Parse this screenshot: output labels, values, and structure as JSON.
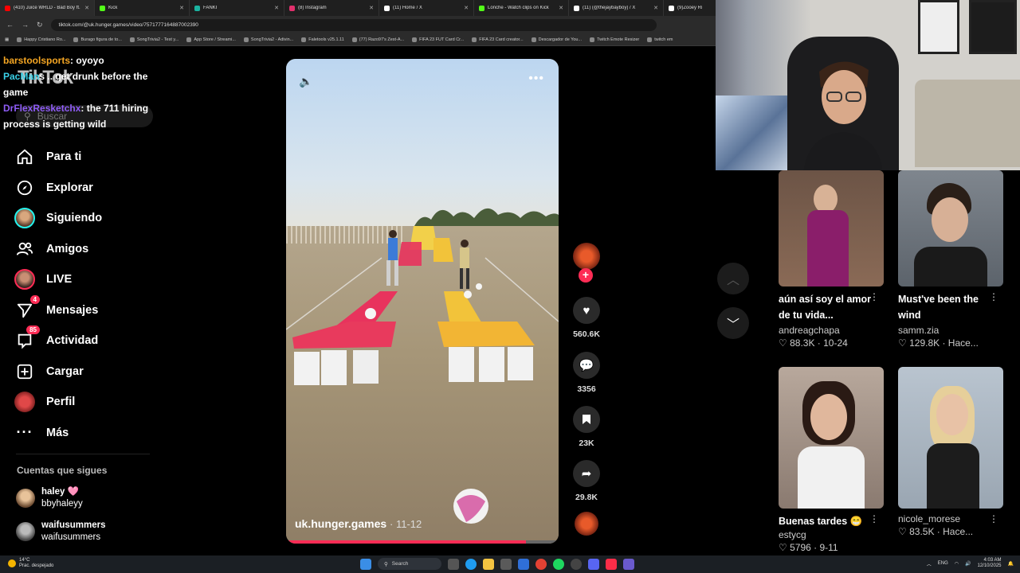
{
  "browser": {
    "tabs": [
      {
        "title": "(410) Juice WRLD - Bad Boy ft.",
        "color": "#ff0000"
      },
      {
        "title": "Kick",
        "color": "#53fc18"
      },
      {
        "title": "FANKI",
        "color": "#1bb3a0"
      },
      {
        "title": "(8) Instagram",
        "color": "#e1306c"
      },
      {
        "title": "(11) Home / X",
        "color": "#ffffff"
      },
      {
        "title": "Lonche - Watch clips on Kick",
        "color": "#53fc18"
      },
      {
        "title": "(11) (@thejaybayboy) / X",
        "color": "#ffffff"
      },
      {
        "title": "(9)Zooey Ri",
        "color": "#ffffff"
      }
    ],
    "url": "tiktok.com/@uk.hunger.games/video/7571777164887002390",
    "bookmarks": [
      "Happy Cristiano Ro...",
      "Burago figura de to...",
      "SongTrivia2 - Test y...",
      "App Store / Streami...",
      "SongTrivia2 - Adivin...",
      "Faletools v25.1.11",
      "(77) Razo97's Zest-A...",
      "FIFA 23 FUT Card Cr...",
      "FIFA 23 Card creator...",
      "Descargador de You...",
      "Twitch Emote Resizer",
      "twitch em"
    ]
  },
  "sidebar": {
    "logo": "TikTok",
    "search_placeholder": "Buscar",
    "nav": [
      {
        "label": "Para ti",
        "icon": "home-icon"
      },
      {
        "label": "Explorar",
        "icon": "compass-icon"
      },
      {
        "label": "Siguiendo",
        "icon": "following-avatar"
      },
      {
        "label": "Amigos",
        "icon": "friends-icon"
      },
      {
        "label": "LIVE",
        "icon": "live-avatar"
      },
      {
        "label": "Mensajes",
        "icon": "messages-icon",
        "badge": "4"
      },
      {
        "label": "Actividad",
        "icon": "activity-icon",
        "badge": "85"
      },
      {
        "label": "Cargar",
        "icon": "upload-icon"
      },
      {
        "label": "Perfil",
        "icon": "profile-avatar"
      },
      {
        "label": "Más",
        "icon": "more-icon"
      }
    ],
    "following_title": "Cuentas que sigues",
    "following": [
      {
        "name": "haley 🩷",
        "handle": "bbyhaleyy"
      },
      {
        "name": "waifusummers",
        "handle": "waifusummers"
      }
    ]
  },
  "chat": [
    {
      "user": "barstoolsports",
      "message": ": oyoyo"
    },
    {
      "user": "PacMan",
      "message": "s ..  get drunk before the game"
    },
    {
      "user": "DrFlexResketchx",
      "message": ": the 711 hiring process is getting wild"
    }
  ],
  "video": {
    "caption_user": "uk.hunger.games",
    "caption_date": "· 11-12",
    "progress": 0.88,
    "likes": "560.6K",
    "comments": "3356",
    "saves": "23K",
    "shares": "29.8K"
  },
  "recommended": [
    {
      "title": "aún así soy el amor de tu vida...",
      "user": "andreagchapa",
      "stats": "♡ 88.3K · 10-24"
    },
    {
      "title": "Must've been the wind",
      "user": "samm.zia",
      "stats": "♡ 129.8K · Hace..."
    },
    {
      "title": "Buenas tardes 😁",
      "user": "estycg",
      "stats": "♡ 5796 · 9-11"
    },
    {
      "title": "",
      "user": "nicole_morese",
      "stats": "♡ 83.5K · Hace..."
    }
  ],
  "taskbar": {
    "weather_temp": "14°C",
    "weather_desc": "Prac. despejado",
    "search": "Search",
    "lang": "ENG",
    "time": "4:03 AM",
    "date": "12/10/2025"
  },
  "colors": {
    "accent": "#fe2c55",
    "chat_user_1": "#f5a623",
    "chat_user_2": "#3ad1e8",
    "chat_user_3": "#8f5cf7"
  }
}
